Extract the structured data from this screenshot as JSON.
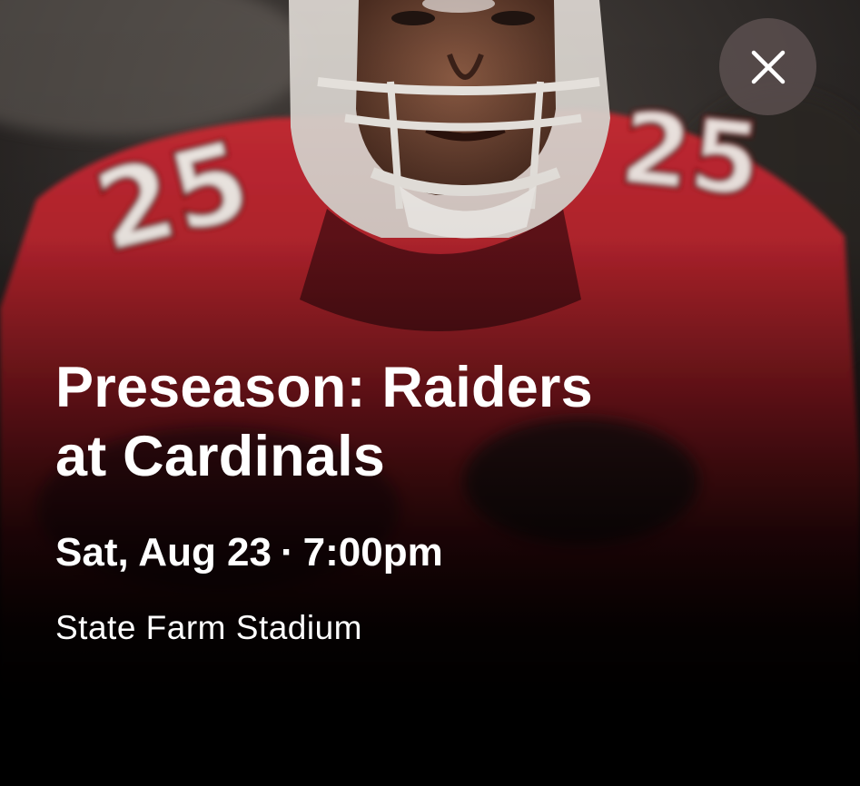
{
  "event": {
    "title_line1": "Preseason: Raiders",
    "title_line2": "at Cardinals",
    "date": "Sat, Aug 23",
    "separator": "·",
    "time": "7:00pm",
    "venue": "State Farm Stadium"
  },
  "hero_image": {
    "subject": "football player in red jersey number 25 wearing helmet",
    "jersey_number": "25"
  },
  "close_button": {
    "icon": "close-icon"
  },
  "colors": {
    "jersey_red": "#b3202a",
    "background": "#000000",
    "text": "#ffffff",
    "close_button_bg": "#5f5252"
  }
}
